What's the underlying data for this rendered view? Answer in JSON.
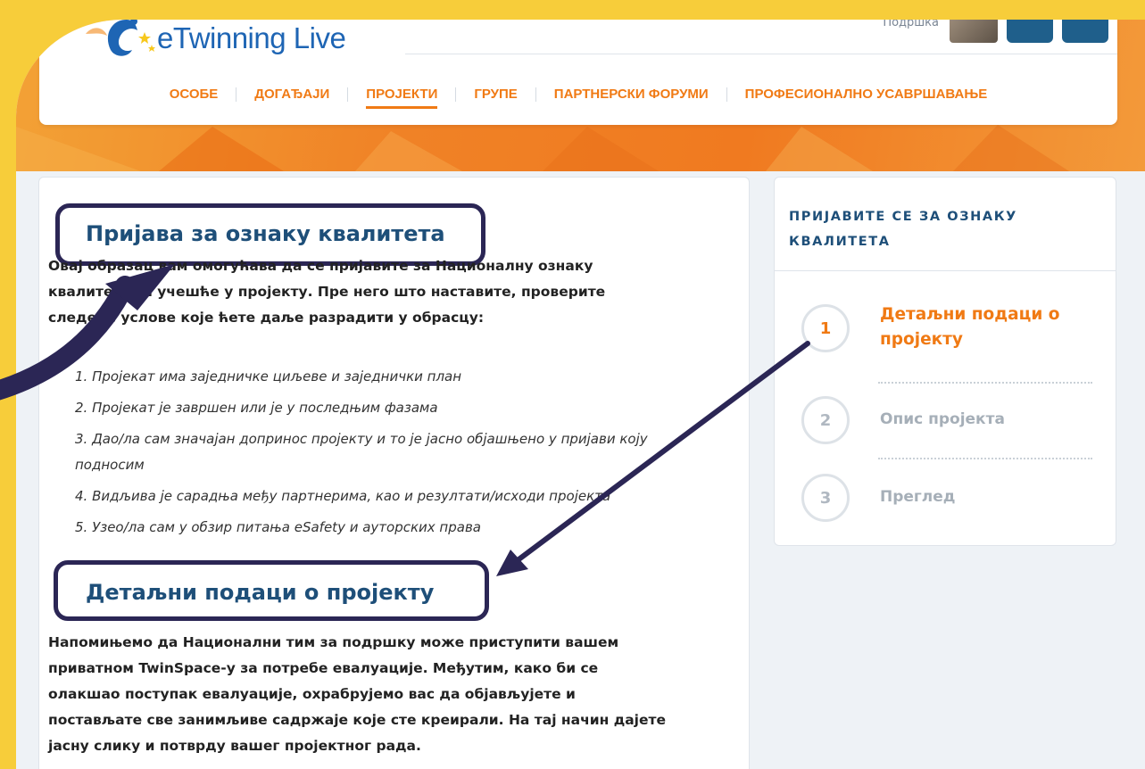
{
  "header": {
    "logo_text": "eTwinning Live",
    "user_label": "Подршка",
    "nav": [
      {
        "label": "ОСОБЕ",
        "active": false
      },
      {
        "label": "ДОГАЂАЈИ",
        "active": false
      },
      {
        "label": "ПРОЈЕКТИ",
        "active": true
      },
      {
        "label": "ГРУПЕ",
        "active": false
      },
      {
        "label": "ПАРТНЕРСКИ ФОРУМИ",
        "active": false
      },
      {
        "label": "ПРОФЕСИОНАЛНО УСАВРШАВАЊЕ",
        "active": false
      }
    ]
  },
  "main": {
    "title": "Пријава за ознаку квалитета",
    "intro": "Овај образац вам омогућава да се пријавите за Националну ознаку квалитета за учешће у пројекту. Пре него што наставите, проверите следеће услове које ћете даље разрадити у обрасцу:",
    "conditions": [
      "1. Пројекат има заједничке циљеве и заједнички план",
      "2. Пројекат је завршен или је у последњим фазама",
      "3. Дао/ла сам значајан допринос пројекту и то је јасно објашњено у пријави коју подносим",
      "4. Видљива је сарадња међу партнерима, као и резултати/исходи пројекта",
      "5. Узео/ла сам у обзир питања eSafety и ауторских права"
    ],
    "section_title": "Детаљни подаци о пројекту",
    "section_text": "Напомињемо да Национални тим за подршку може приступити вашем приватном TwinSpace-у за потребе евалуације. Међутим, како би се олакшао поступак евалуације, охрабрујемо вас да објављујете и постављате све занимљиве садржаје које сте креирали. На тај начин дајете јасну слику и потврду вашег пројектног рада."
  },
  "sidebar": {
    "title": "ПРИЈАВИТЕ СЕ ЗА ОЗНАКУ КВАЛИТЕТА",
    "steps": [
      {
        "number": "1",
        "label": "Детаљни подаци о пројекту",
        "active": true
      },
      {
        "number": "2",
        "label": "Опис пројекта",
        "active": false
      },
      {
        "number": "3",
        "label": "Преглед",
        "active": false
      }
    ]
  },
  "colors": {
    "accent_orange": "#f07a14",
    "heading_blue": "#1e4f79",
    "annotation_navy": "#2b2655",
    "frame_yellow": "#f7cd3a"
  }
}
